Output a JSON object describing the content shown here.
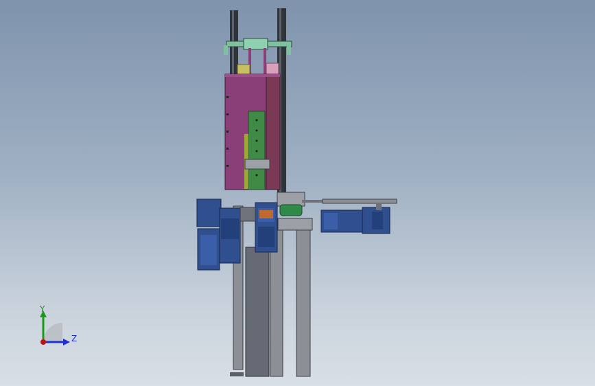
{
  "viewport": {
    "background_top": "#7f93ad",
    "background_bottom": "#d9dfe6"
  },
  "triad": {
    "y_label": "Y",
    "z_label": "Z",
    "y_color": "#1a9a1a",
    "z_color": "#1f2fd0",
    "x_color": "#c01010"
  },
  "model": {
    "hopper_color": "#8a3f78",
    "rail_color": "#39404a",
    "motor_color": "#2f4f8f",
    "frame_color": "#8c8f96",
    "green_part_color": "#3f8a44",
    "slot_yellow": "#c8c060",
    "slot_pink": "#d9a0bc",
    "bracket_color": "#7fc0a0"
  }
}
